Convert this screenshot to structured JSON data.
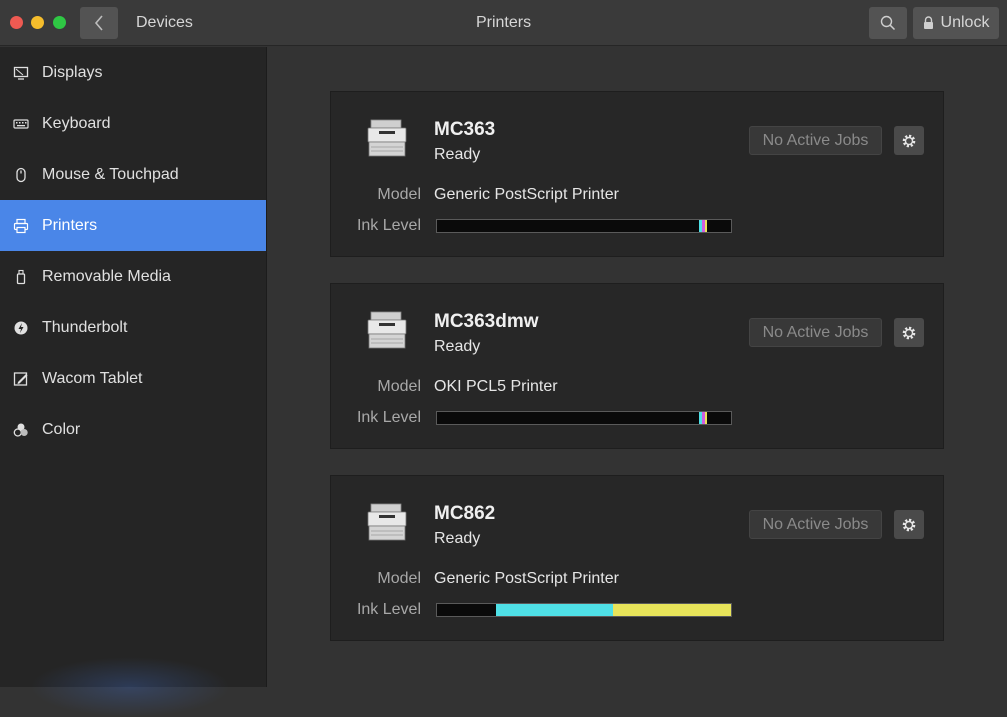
{
  "window": {
    "breadcrumb": "Devices",
    "title": "Printers",
    "unlock_label": "Unlock"
  },
  "sidebar": {
    "items": [
      {
        "label": "Displays",
        "icon": "display-icon"
      },
      {
        "label": "Keyboard",
        "icon": "keyboard-icon"
      },
      {
        "label": "Mouse & Touchpad",
        "icon": "mouse-icon"
      },
      {
        "label": "Printers",
        "icon": "printer-icon",
        "active": true
      },
      {
        "label": "Removable Media",
        "icon": "usb-icon"
      },
      {
        "label": "Thunderbolt",
        "icon": "thunderbolt-icon"
      },
      {
        "label": "Wacom Tablet",
        "icon": "tablet-icon"
      },
      {
        "label": "Color",
        "icon": "color-icon"
      }
    ],
    "accent": "#4a86e8"
  },
  "labels": {
    "model": "Model",
    "ink_level": "Ink Level"
  },
  "printers": [
    {
      "name": "MC363",
      "status": "Ready",
      "model": "Generic PostScript Printer",
      "jobs_label": "No Active Jobs",
      "ink_levels": {
        "black": 0.89,
        "cyan": 0.01,
        "magenta": 0.01,
        "yellow": 0.01
      }
    },
    {
      "name": "MC363dmw",
      "status": "Ready",
      "model": "OKI PCL5 Printer",
      "jobs_label": "No Active Jobs",
      "ink_levels": {
        "black": 0.89,
        "cyan": 0.01,
        "magenta": 0.01,
        "yellow": 0.01
      }
    },
    {
      "name": "MC862",
      "status": "Ready",
      "model": "Generic PostScript Printer",
      "jobs_label": "No Active Jobs",
      "ink_levels": {
        "black": 0.2,
        "cyan": 0.4,
        "magenta": 0.0,
        "yellow": 0.4
      }
    }
  ],
  "colors": {
    "black_ink": "#0a0a0a",
    "cyan_ink": "#4fe0e6",
    "magenta_ink": "#d060e0",
    "yellow_ink": "#e8e45a"
  }
}
